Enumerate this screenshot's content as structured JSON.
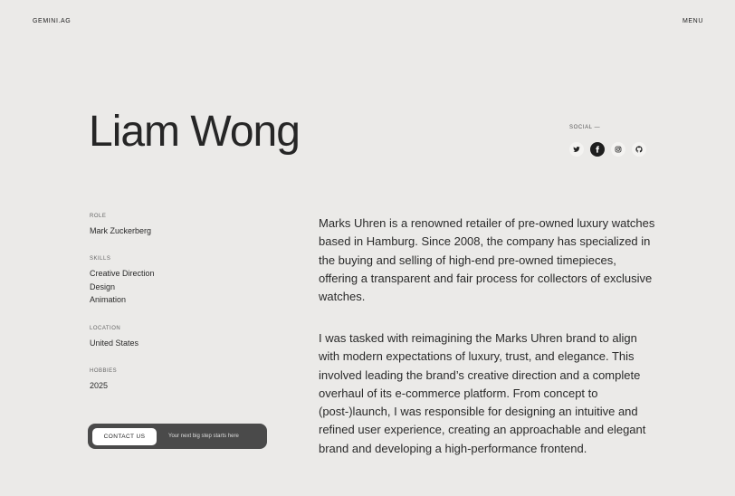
{
  "header": {
    "brand": "GEMINI.AG",
    "menu_label": "MENU"
  },
  "hero": {
    "name": "Liam Wong"
  },
  "social": {
    "label": "SOCIAL —",
    "icons": [
      "twitter-icon",
      "facebook-icon",
      "instagram-icon",
      "github-icon"
    ]
  },
  "meta": {
    "role_label": "ROLE",
    "role_value": "Mark Zuckerberg",
    "skills_label": "SKILLS",
    "skills": [
      "Creative Direction",
      "Design",
      "Animation"
    ],
    "location_label": "LOCATION",
    "location_value": "United States",
    "hobbies_label": "HOBBIES",
    "hobbies_value": "2025"
  },
  "contact": {
    "button_label": "CONTACT US",
    "note": "Your next big step starts here"
  },
  "description": {
    "paragraph_1": "Marks Uhren is a renowned retailer of pre-owned luxury watches based in Hamburg. Since 2008, the company has specialized in the buying and selling of high-end pre-owned timepieces, offering a transparent and fair process for collectors of exclusive watches.",
    "paragraph_2": "I was tasked with reimagining the Marks Uhren brand to align with modern expectations of luxury, trust, and elegance. This involved leading the brand’s creative direction and a complete overhaul of its e-commerce platform. From concept to (post-)launch, I was responsible for designing an intuitive and refined user experience, creating an approachable and elegant brand and developing a high-performance frontend."
  },
  "colors": {
    "background": "#ebeae8",
    "text": "#2a2a2a",
    "contact_bar": "#4a4a4a",
    "active_social": "#1e1e1e"
  }
}
